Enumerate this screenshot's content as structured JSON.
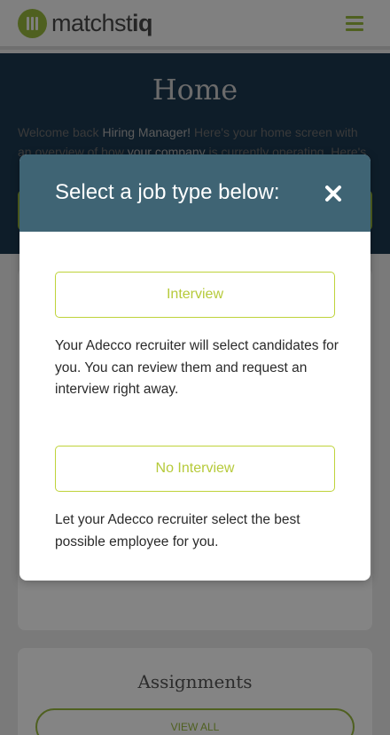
{
  "header": {
    "logo_text_light": "matchst",
    "logo_text_bold": "iq"
  },
  "hero": {
    "title": "Home",
    "text_welcome": "Welcome back ",
    "text_user": "Hiring Manager!",
    "text_rest": " Here's your home screen with an overview of how ",
    "text_company": "your company",
    "text_tail": " is currently operating. Here's"
  },
  "assignments": {
    "title": "Assignments",
    "view_all_label": "VIEW ALL"
  },
  "modal": {
    "title": "Select a job type below:",
    "options": [
      {
        "label": "Interview",
        "description": "Your Adecco recruiter will select candidates for you. You can review them and request an interview right away."
      },
      {
        "label": "No Interview",
        "description": "Let your Adecco recruiter select the best possible employee for you."
      }
    ]
  },
  "colors": {
    "modal_header": "#3f6474",
    "accent_green": "#bfd33a",
    "overlay": "#7a7a7a"
  },
  "icons": {
    "close": "close-icon",
    "menu": "hamburger-menu-icon",
    "logo": "matchstiq-logo-icon"
  }
}
